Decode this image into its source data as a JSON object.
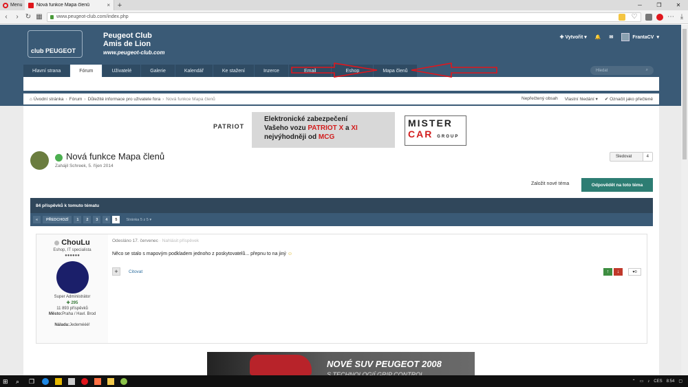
{
  "browser": {
    "menu_label": "Menu",
    "tab_title": "Nová funkce Mapa členů",
    "tab_close": "×",
    "newtab": "+",
    "url": "www.peugeot-club.com/index.php",
    "win_min": "─",
    "win_max": "❐",
    "win_close": "✕"
  },
  "header": {
    "club_line1": "Peugeot Club",
    "club_line2": "Amis de Lion",
    "club_url": "www.peugeot-club.com",
    "logo_text": "club PEUGEOT",
    "create_label": "Vytvořit",
    "username": "FrantaCV"
  },
  "nav": {
    "tabs": [
      {
        "label": "Hlavní strana"
      },
      {
        "label": "Fórum"
      },
      {
        "label": "Uživatelé"
      },
      {
        "label": "Galerie"
      },
      {
        "label": "Kalendář"
      },
      {
        "label": "Ke stažení"
      },
      {
        "label": "Inzerce"
      },
      {
        "label": "Email"
      },
      {
        "label": "Eshop"
      },
      {
        "label": "Mapa členů"
      }
    ],
    "search_placeholder": "Hledat"
  },
  "breadcrumb": {
    "items": [
      "Úvodní stránka",
      "Fórum",
      "Důležité informace pro uživatele fora",
      "Nová funkce Mapa členů"
    ],
    "unread": "Nepřečtený obsah",
    "custom_search": "Vlastní hledání",
    "mark_read": "Označit jako přečtené"
  },
  "ad_top": {
    "patriot": "PATRIOT",
    "line1": "Elektronické zabezpečení",
    "line2a": "Vašeho vozu ",
    "line2b": "PATRIOT X",
    "line2c": " a ",
    "line2d": "XI",
    "line3a": "nejvýhodněji od ",
    "line3b": "MCG",
    "mister1": "MISTER",
    "mister2": "CAR",
    "mister3": "GROUP"
  },
  "thread": {
    "title": "Nová funkce Mapa členů",
    "meta_prefix": "Zahájil Schreek, ",
    "meta_date": "5. říjen 2014",
    "follow_label": "Sledovat",
    "follow_count": "4",
    "new_topic": "Založit nové téma",
    "reply": "Odpovědět na toto téma",
    "posts_count": "84 příspěvků k tomuto tématu"
  },
  "pager": {
    "first": "«",
    "prev": "PŘEDCHOZÍ",
    "pages": [
      "1",
      "2",
      "3",
      "4",
      "5"
    ],
    "current": "5",
    "info": "Stránka 5 z 5"
  },
  "post": {
    "author": "ChouLu",
    "author_title": "Eshop, IT specialista",
    "pips": "●●●●●●",
    "role": "Super Administrátor",
    "reputation": "295",
    "post_count": "11 893 příspěvků",
    "city_label": "Město:",
    "city": "Praha / Havl. Brod",
    "mood_label": "Nálada:",
    "mood": "Jedemééé!",
    "date": "Odesláno 17. červenec",
    "date_muted": " · Nahlásit příspěvek",
    "text": "Něco se stalo s mapovým podkladem jednoho z poskytovatelů... přepnu to na jiný",
    "quote": "Citovat",
    "likes": "0"
  },
  "ad_bottom": {
    "title": "NOVÉ SUV PEUGEOT 2008",
    "subtitle": "S TECHNOLOGIÍ GRIP CONTROL"
  },
  "taskbar": {
    "lang": "CES",
    "time": "8:54"
  },
  "colors": {
    "header_bg": "#3a5a76",
    "reply_btn": "#2d7d73",
    "annotation_red": "#e0161c"
  }
}
